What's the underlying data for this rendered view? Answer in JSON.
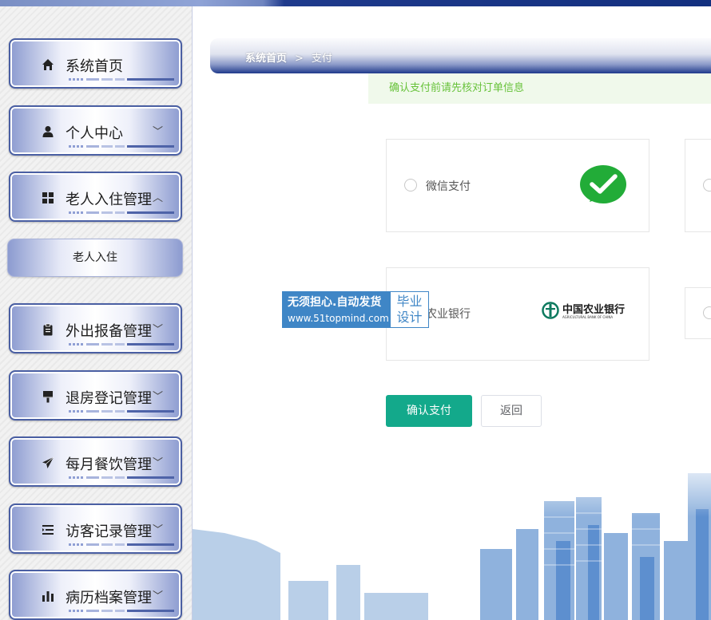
{
  "sidebar": {
    "items": [
      {
        "label": "系统首页",
        "icon": "home-icon",
        "chevron": ""
      },
      {
        "label": "个人中心",
        "icon": "user-icon",
        "chevron": "﹀"
      },
      {
        "label": "老人入住管理",
        "icon": "grid-icon",
        "chevron": "︿"
      },
      {
        "label": "外出报备管理",
        "icon": "clipboard-icon",
        "chevron": "﹀"
      },
      {
        "label": "退房登记管理",
        "icon": "brush-icon",
        "chevron": "﹀"
      },
      {
        "label": "每月餐饮管理",
        "icon": "send-icon",
        "chevron": "﹀"
      },
      {
        "label": "访客记录管理",
        "icon": "list-icon",
        "chevron": "﹀"
      },
      {
        "label": "病历档案管理",
        "icon": "bar-chart-icon",
        "chevron": "﹀"
      }
    ],
    "submenu": {
      "label": "老人入住"
    }
  },
  "breadcrumb": {
    "home": "系统首页",
    "separator": ">",
    "current": "支付"
  },
  "notice": "确认支付前请先核对订单信息",
  "payment": {
    "options": [
      {
        "label": "微信支付",
        "logo": "wechat-pay-logo"
      },
      {
        "label": "农业银行",
        "logo": "abc-bank-logo",
        "logo_text": "中国农业银行",
        "logo_subtext": "AGRICULTURAL BANK OF CHINA"
      }
    ]
  },
  "watermark": {
    "line1": "无须担心.自动发货",
    "line2": "www.51topmind.com",
    "tag_top": "毕业",
    "tag_bottom": "设计"
  },
  "buttons": {
    "confirm": "确认支付",
    "back": "返回"
  },
  "colors": {
    "primary": "#13a98b",
    "nav_dark": "#1f3a8c",
    "notice_text": "#67c23a",
    "notice_bg": "#f0f9eb",
    "watermark": "#3f86c6"
  }
}
